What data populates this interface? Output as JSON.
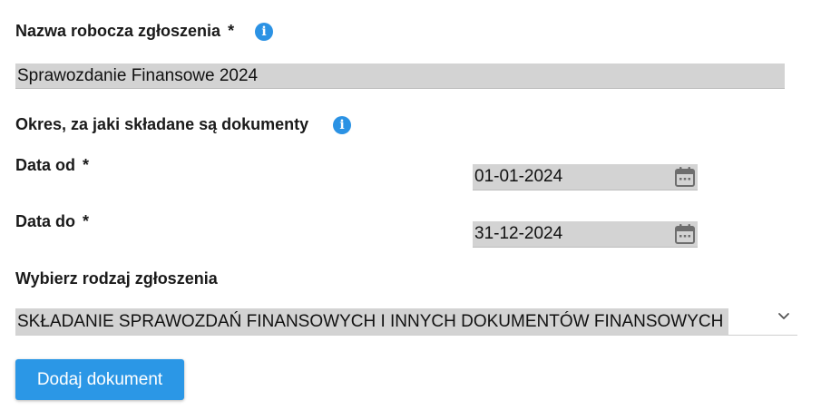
{
  "form": {
    "name_field": {
      "label": "Nazwa robocza zgłoszenia",
      "required_mark": "*",
      "value": "Sprawozdanie Finansowe 2024"
    },
    "period": {
      "heading": "Okres, za jaki składane są dokumenty"
    },
    "date_from": {
      "label": "Data od",
      "required_mark": "*",
      "value": "01-01-2024"
    },
    "date_to": {
      "label": "Data do",
      "required_mark": "*",
      "value": "31-12-2024"
    },
    "type_select": {
      "label": "Wybierz rodzaj zgłoszenia",
      "selected": "SKŁADANIE SPRAWOZDAŃ FINANSOWYCH I INNYCH DOKUMENTÓW FINANSOWYCH"
    },
    "submit": {
      "label": "Dodaj dokument"
    },
    "info_glyph": "i"
  },
  "icons": {
    "info": "info-icon",
    "calendar": "calendar-icon",
    "chevron": "chevron-down-icon"
  },
  "colors": {
    "accent": "#2b97e6",
    "info_icon": "#2b92e4",
    "input_bg": "#d3d3d3",
    "calendar_icon": "#6e6e6e"
  }
}
